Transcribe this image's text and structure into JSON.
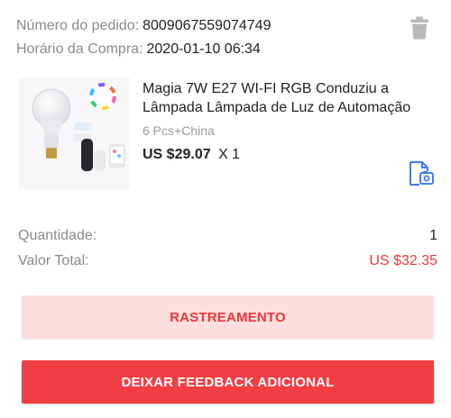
{
  "order": {
    "number_label": "Número do pedido:",
    "number_value": "8009067559074749",
    "date_label": "Horário da Compra:",
    "date_value": "2020-01-10 06:34"
  },
  "product": {
    "title_line1": "Magia 7W E27 WI-FI RGB Conduziu a",
    "title_line2": "Lâmpada Lâmpada de Luz de Automação",
    "variant": "6 Pcs+China",
    "price": "US $29.07",
    "quantity": "X 1"
  },
  "summary": {
    "quantity_label": "Quantidade:",
    "quantity_value": "1",
    "total_label": "Valor Total:",
    "total_value": "US $32.35"
  },
  "buttons": {
    "tracking": "RASTREAMENTO",
    "feedback": "DEIXAR FEEDBACK ADICIONAL"
  },
  "icons": {
    "delete": "trash-icon",
    "details": "document-image-icon"
  },
  "colors": {
    "accent": "#e8383d",
    "accent_light": "#fcdede",
    "icon_blue": "#3d7ff0",
    "muted_text": "#8a8a8a"
  }
}
